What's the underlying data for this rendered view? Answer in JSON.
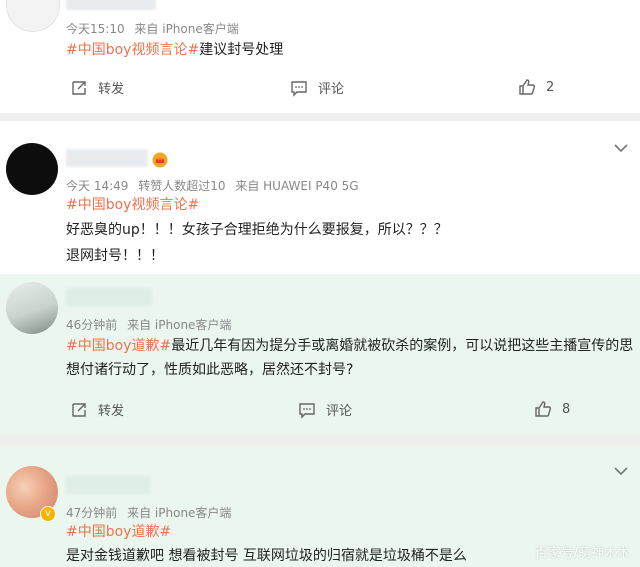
{
  "colors": {
    "accent": "#eb7350",
    "green_bg": "#eaf6ee"
  },
  "comments": [
    {
      "meta": {
        "time": "今天15:10",
        "source": "来自 iPhone客户端"
      },
      "tag": "#中国boy视频言论#",
      "text": "建议封号处理",
      "actions": {
        "repost": "转发",
        "comment": "评论",
        "likes": "2"
      }
    },
    {
      "meta": {
        "time": "今天 14:49",
        "extra": "转赞人数超过10",
        "source": "来自 HUAWEI P40 5G"
      },
      "tag": "#中国boy视频言论#",
      "lines": [
        "好恶臭的up！！！女孩子合理拒绝为什么要报复，所以？？？",
        "退网封号！！！"
      ],
      "menu_icon": "chevron-down-icon"
    },
    {
      "meta": {
        "time": "46分钟前",
        "source": "来自 iPhone客户端"
      },
      "tag": "#中国boy道歉#",
      "text": "最近几年有因为提分手或离婚就被砍杀的案例，可以说把这些主播宣传的思想付诸行动了，性质如此恶略，居然还不封号?",
      "actions": {
        "repost": "转发",
        "comment": "评论",
        "likes": "8"
      }
    },
    {
      "meta": {
        "time": "47分钟前",
        "source": "来自 iPhone客户端"
      },
      "tag": "#中国boy道歉#",
      "text": "是对金钱道歉吧 想看被封号 互联网垃圾的归宿就是垃圾桶不是么",
      "menu_icon": "chevron-down-icon"
    }
  ],
  "watermark": "百家号/萌神木木"
}
